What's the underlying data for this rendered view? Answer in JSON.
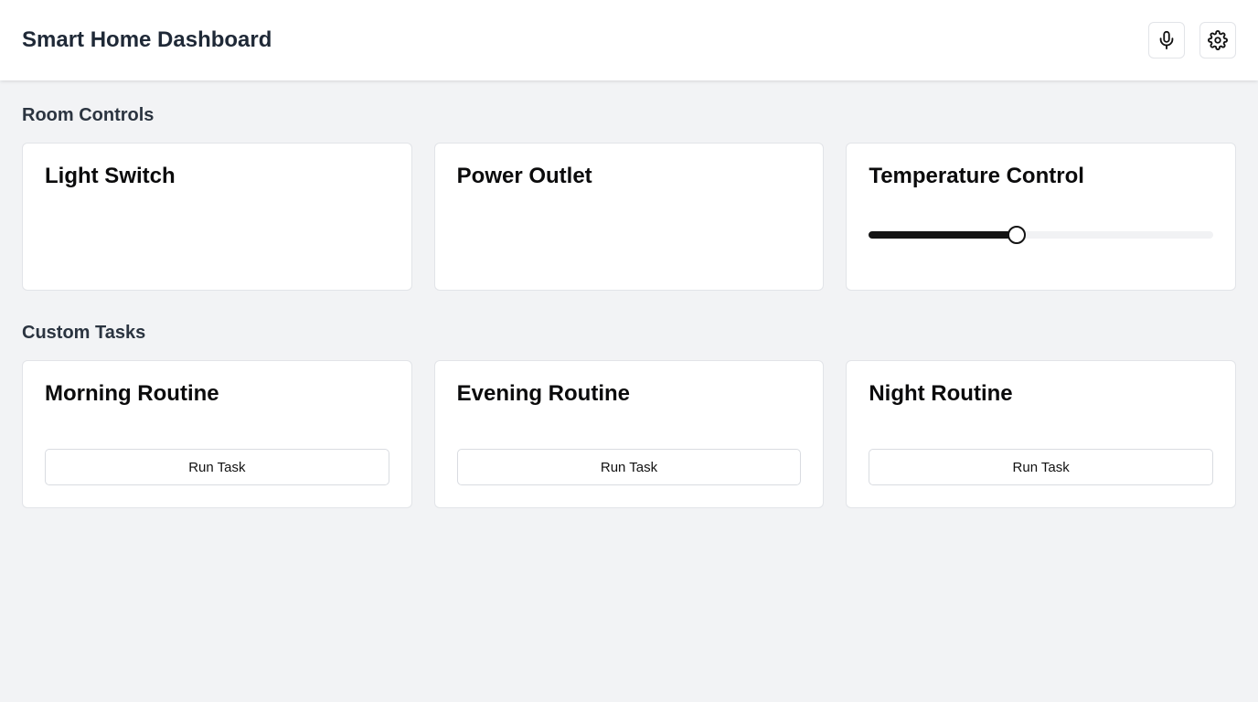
{
  "header": {
    "title": "Smart Home Dashboard",
    "actions": [
      {
        "icon": "microphone-icon"
      },
      {
        "icon": "gear-icon"
      }
    ]
  },
  "room_controls": {
    "title": "Room Controls",
    "cards": [
      {
        "title": "Light Switch"
      },
      {
        "title": "Power Outlet"
      },
      {
        "title": "Temperature Control",
        "slider_level_percent": 43
      }
    ]
  },
  "custom_tasks": {
    "title": "Custom Tasks",
    "cards": [
      {
        "title": "Morning Routine",
        "button_label": "Run Task"
      },
      {
        "title": "Evening Routine",
        "button_label": "Run Task"
      },
      {
        "title": "Night Routine",
        "button_label": "Run Task"
      }
    ]
  },
  "colors": {
    "background": "#f2f3f5",
    "card": "#ffffff",
    "slider_fill": "#141414",
    "slider_track": "#f1f2f4"
  }
}
